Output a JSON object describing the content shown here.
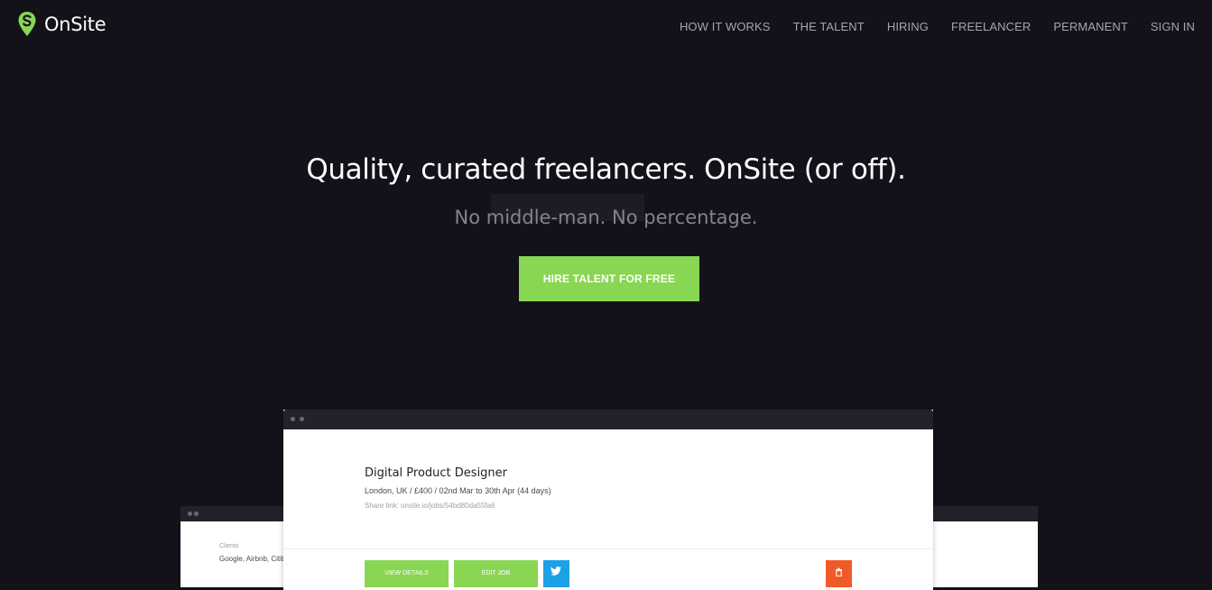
{
  "brand": {
    "name": "OnSite",
    "accent_color": "#89d653"
  },
  "nav": {
    "items": [
      {
        "label": "HOW IT WORKS"
      },
      {
        "label": "THE TALENT"
      },
      {
        "label": "HIRING"
      },
      {
        "label": "FREELANCER"
      },
      {
        "label": "PERMANENT"
      },
      {
        "label": "SIGN IN"
      }
    ]
  },
  "hero": {
    "title": "Quality, curated freelancers. OnSite (or off).",
    "subtitle": "No middle-man. No percentage.",
    "cta_label": "HIRE TALENT FOR FREE"
  },
  "preview_back": {
    "clients_label": "Clients",
    "clients_value": "Google, Airbnb, Citibank"
  },
  "preview_front": {
    "job_title": "Digital Product Designer",
    "job_meta": "London, UK / £400 / 02nd Mar to 30th Apr (44 days)",
    "share_link": "Share link: onsite.io/jobs/54bd80da55fa6",
    "view_details_label": "VIEW DETAILS",
    "edit_job_label": "EDIT JOB",
    "twitter_icon": "twitter-icon",
    "delete_icon": "trash-icon"
  },
  "colors": {
    "background": "#13121a",
    "nav_text": "#a5a4ab",
    "twitter": "#1da1e6",
    "delete": "#f05a28"
  }
}
